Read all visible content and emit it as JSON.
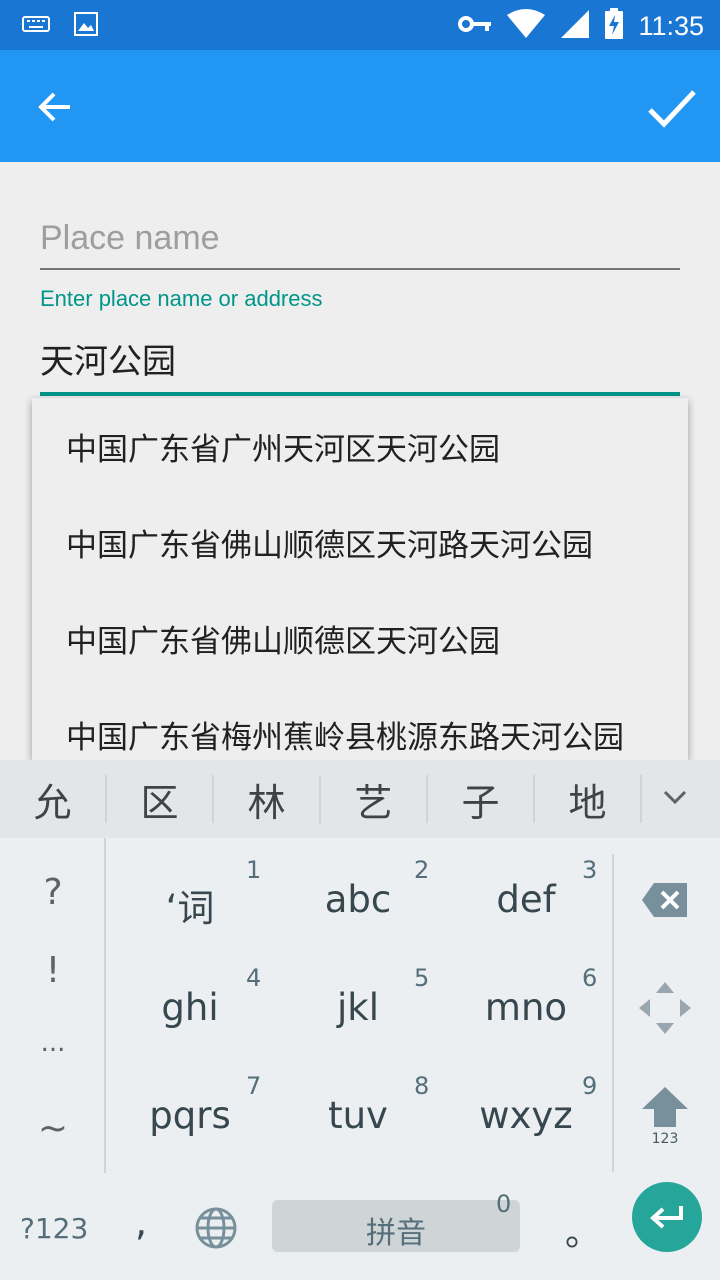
{
  "status_bar": {
    "time": "11:35",
    "left_icons": [
      "keyboard-icon",
      "image-icon"
    ],
    "right_icons": [
      "vpn-key-icon",
      "wifi-icon",
      "signal-icon",
      "battery-charging-icon"
    ]
  },
  "app_bar": {
    "back_icon": "arrow-back-icon",
    "confirm_icon": "check-icon",
    "color": "#2196f3"
  },
  "form": {
    "place_name_placeholder": "Place name",
    "address_label": "Enter place name or address",
    "address_value": "天河公园",
    "accent_color": "#009688"
  },
  "suggestions": [
    "中国广东省广州天河区天河公园",
    "中国广东省佛山顺德区天河路天河公园",
    "中国广东省佛山顺德区天河公园",
    "中国广东省梅州蕉岭县桃源东路天河公园"
  ],
  "keyboard": {
    "candidates": [
      "允",
      "区",
      "林",
      "艺",
      "子",
      "地"
    ],
    "left_column": [
      "?",
      "!",
      "...",
      "~"
    ],
    "t9_keys": [
      {
        "label": "‘词",
        "num": "1"
      },
      {
        "label": "abc",
        "num": "2"
      },
      {
        "label": "def",
        "num": "3"
      },
      {
        "label": "ghi",
        "num": "4"
      },
      {
        "label": "jkl",
        "num": "5"
      },
      {
        "label": "mno",
        "num": "6"
      },
      {
        "label": "pqrs",
        "num": "7"
      },
      {
        "label": "tuv",
        "num": "8"
      },
      {
        "label": "wxyz",
        "num": "9"
      }
    ],
    "shift_sub": "123",
    "symbols_key": "?123",
    "comma": ",",
    "space_label": "拼音",
    "space_num": "0",
    "period": "。",
    "enter_color": "#26a69a"
  }
}
